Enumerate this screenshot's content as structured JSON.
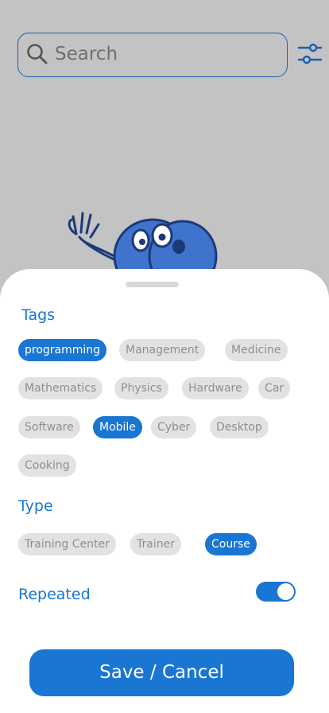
{
  "search": {
    "placeholder": "Search"
  },
  "colors": {
    "accent": "#1976d2",
    "chip_bg": "#e2e2e2",
    "chip_text": "#8f8f8f",
    "overlay": "#c3c3c3"
  },
  "filter_sheet": {
    "tags_title": "Tags",
    "tags": [
      {
        "label": "programming",
        "selected": true
      },
      {
        "label": "Management",
        "selected": false
      },
      {
        "label": "Medicine",
        "selected": false
      },
      {
        "label": "Mathematics",
        "selected": false
      },
      {
        "label": "Physics",
        "selected": false
      },
      {
        "label": "Hardware",
        "selected": false
      },
      {
        "label": "Car",
        "selected": false
      },
      {
        "label": "Software",
        "selected": false
      },
      {
        "label": "Mobile",
        "selected": true
      },
      {
        "label": "Cyber",
        "selected": false
      },
      {
        "label": "Desktop",
        "selected": false
      },
      {
        "label": "Cooking",
        "selected": false
      }
    ],
    "type_title": "Type",
    "types": [
      {
        "label": "Training Center",
        "selected": false
      },
      {
        "label": "Trainer",
        "selected": false
      },
      {
        "label": "Course",
        "selected": true
      }
    ],
    "repeated_label": "Repeated",
    "repeated_on": true,
    "save_label": "Save / Cancel"
  }
}
